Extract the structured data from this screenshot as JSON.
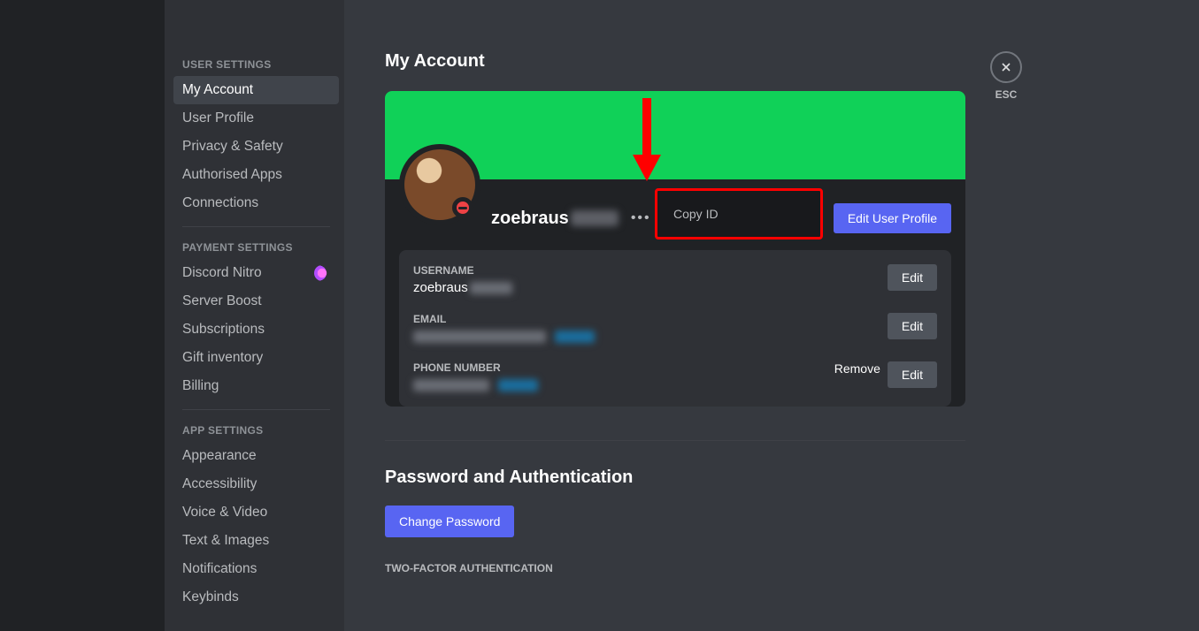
{
  "sidebar": {
    "user_settings_header": "USER SETTINGS",
    "user_items": [
      {
        "label": "My Account",
        "active": true
      },
      {
        "label": "User Profile"
      },
      {
        "label": "Privacy & Safety"
      },
      {
        "label": "Authorised Apps"
      },
      {
        "label": "Connections"
      }
    ],
    "payment_settings_header": "PAYMENT SETTINGS",
    "payment_items": [
      {
        "label": "Discord Nitro",
        "nitro": true
      },
      {
        "label": "Server Boost"
      },
      {
        "label": "Subscriptions"
      },
      {
        "label": "Gift inventory"
      },
      {
        "label": "Billing"
      }
    ],
    "app_settings_header": "APP SETTINGS",
    "app_items": [
      {
        "label": "Appearance"
      },
      {
        "label": "Accessibility"
      },
      {
        "label": "Voice & Video"
      },
      {
        "label": "Text & Images"
      },
      {
        "label": "Notifications"
      },
      {
        "label": "Keybinds"
      }
    ]
  },
  "close": {
    "label": "ESC"
  },
  "page": {
    "title": "My Account",
    "username_display": "zoebraus",
    "edit_profile_btn": "Edit User Profile",
    "context_menu_item": "Copy ID",
    "fields": {
      "username_label": "USERNAME",
      "username_value": "zoebraus",
      "email_label": "EMAIL",
      "phone_label": "PHONE NUMBER",
      "edit_btn": "Edit",
      "remove_btn": "Remove"
    },
    "password_section_title": "Password and Authentication",
    "change_password_btn": "Change Password",
    "twofa_header": "TWO-FACTOR AUTHENTICATION"
  }
}
